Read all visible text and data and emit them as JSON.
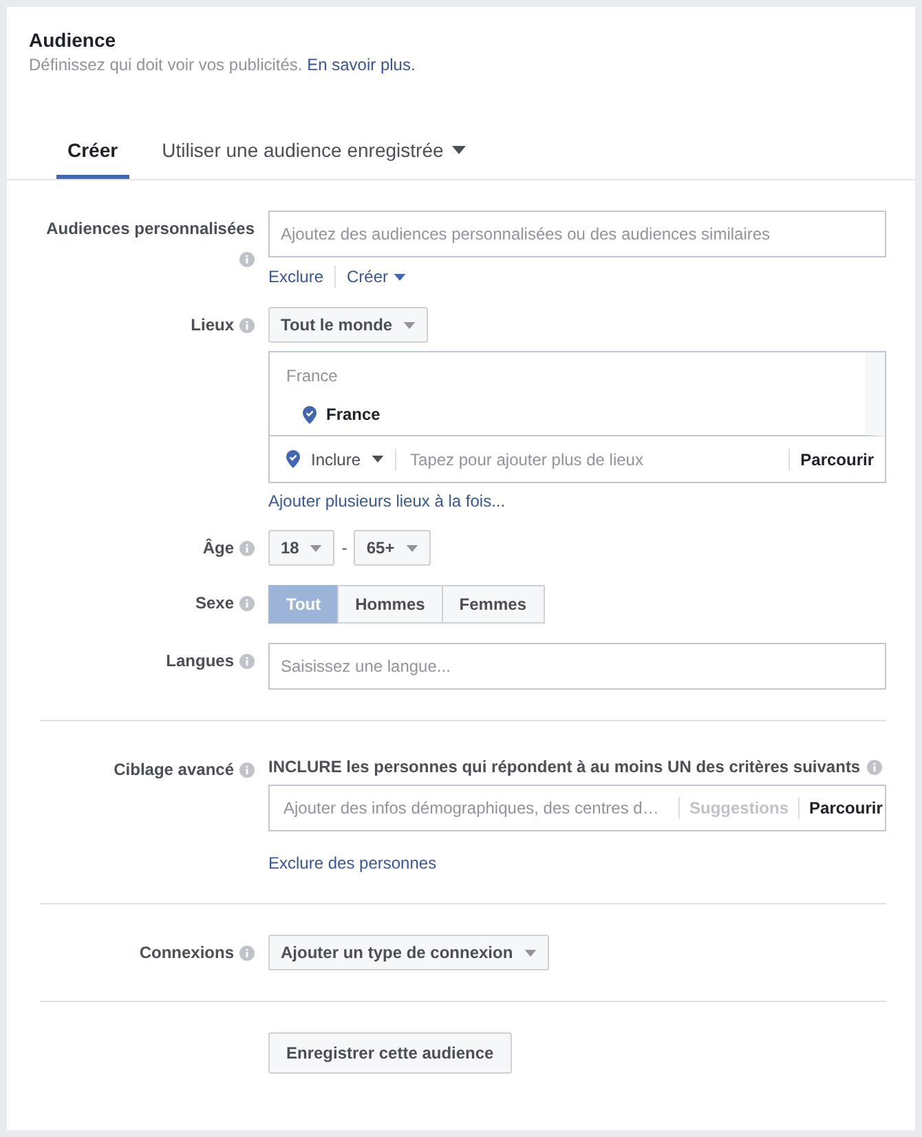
{
  "header": {
    "title": "Audience",
    "description": "Définissez qui doit voir vos publicités.",
    "link": "En savoir plus."
  },
  "tabs": [
    {
      "label": "Créer",
      "selected": true,
      "dropdown": false
    },
    {
      "label": "Utiliser une audience enregistrée",
      "selected": false,
      "dropdown": true
    }
  ],
  "custom_audiences": {
    "label": "Audiences personnalisées",
    "placeholder": "Ajoutez des audiences personnalisées ou des audiences similaires",
    "links": [
      "Exclure",
      "Créer"
    ]
  },
  "locations": {
    "label": "Lieux",
    "scope": "Tout le monde",
    "group": "France",
    "items": [
      "France"
    ],
    "mode": "Inclure",
    "placeholder": "Tapez pour ajouter plus de lieux",
    "browse": "Parcourir",
    "bulk_link": "Ajouter plusieurs lieux à la fois..."
  },
  "age": {
    "label": "Âge",
    "min": "18",
    "separator": "-",
    "max": "65+"
  },
  "gender": {
    "label": "Sexe",
    "options": [
      {
        "label": "Tout",
        "selected": true
      },
      {
        "label": "Hommes",
        "selected": false
      },
      {
        "label": "Femmes",
        "selected": false
      }
    ]
  },
  "languages": {
    "label": "Langues",
    "placeholder": "Saisissez une langue..."
  },
  "detailed_targeting": {
    "label": "Ciblage avancé",
    "instruction": "INCLURE les personnes qui répondent à au moins UN des critères suivants",
    "placeholder": "Ajouter des infos démographiques, des centres d…",
    "suggestions": "Suggestions",
    "suggestions_disabled": true,
    "browse": "Parcourir",
    "exclude_link": "Exclure des personnes"
  },
  "connections": {
    "label": "Connexions",
    "dropdown": "Ajouter un type de connexion"
  },
  "save_button": "Enregistrer cette audience"
}
